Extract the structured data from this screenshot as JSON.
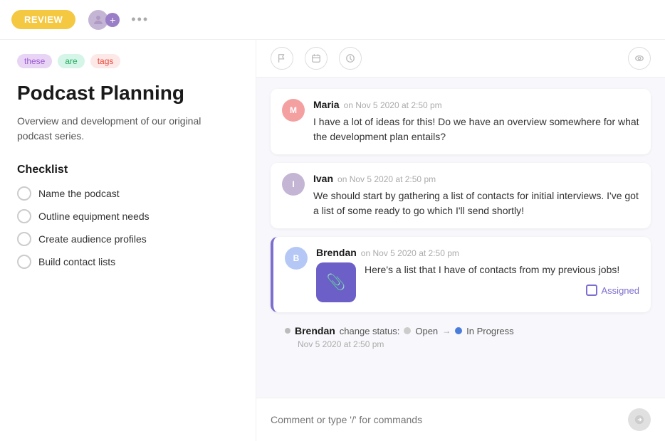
{
  "topbar": {
    "review_label": "REVIEW",
    "more_dots": "•••"
  },
  "tags": [
    {
      "key": "these",
      "label": "these",
      "class": "tag-these"
    },
    {
      "key": "are",
      "label": "are",
      "class": "tag-are"
    },
    {
      "key": "tags",
      "label": "tags",
      "class": "tag-tags"
    }
  ],
  "page": {
    "title": "Podcast Planning",
    "description": "Overview and development of our original podcast series."
  },
  "checklist": {
    "title": "Checklist",
    "items": [
      {
        "label": "Name the podcast"
      },
      {
        "label": "Outline equipment needs"
      },
      {
        "label": "Create audience profiles"
      },
      {
        "label": "Build contact lists"
      }
    ]
  },
  "comments": [
    {
      "author": "Maria",
      "time": "on Nov 5 2020 at 2:50 pm",
      "text": "I have a lot of ideas for this! Do we have an overview somewhere for what the development plan entails?",
      "avatar_class": "avatar-maria"
    },
    {
      "author": "Ivan",
      "time": "on Nov 5 2020 at 2:50 pm",
      "text": "We should start by gathering a list of contacts for initial interviews. I've got a list of some ready to go which I'll send shortly!",
      "avatar_class": "avatar-ivan"
    }
  ],
  "brendan_comment": {
    "author": "Brendan",
    "time": "on Nov 5 2020 at 2:50 pm",
    "text": "Here's a list that I have of contacts from my previous jobs!",
    "assigned_label": "Assigned",
    "attachment_icon": "📎"
  },
  "status_change": {
    "author": "Brendan",
    "action": "change status:",
    "from": "Open",
    "to": "In Progress",
    "time": "Nov 5 2020 at 2:50 pm"
  },
  "comment_input": {
    "placeholder": "Comment or type '/' for commands"
  },
  "icons": {
    "flag": "⚑",
    "calendar": "▭",
    "clock": "◷",
    "eye": "◎",
    "paperclip": "📎"
  }
}
